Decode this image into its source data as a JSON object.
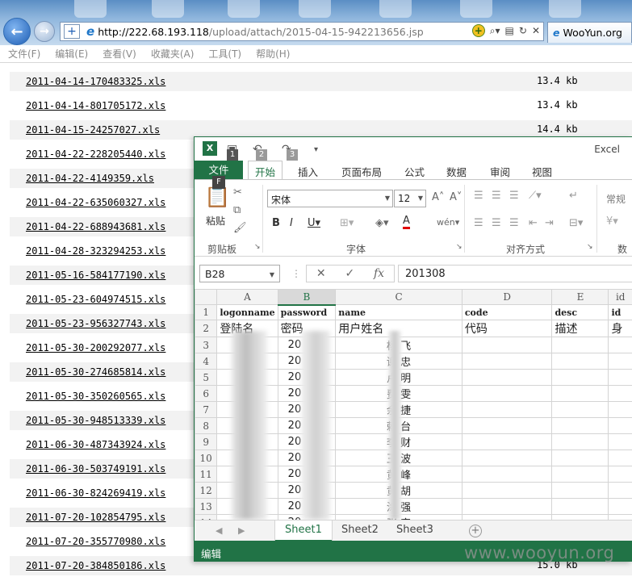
{
  "browser": {
    "url_domain": "http://222.68.193.118",
    "url_path": "/upload/attach/2015-04-15-942213656.jsp",
    "tab_title": "WooYun.org",
    "menu": [
      "文件(F)",
      "编辑(E)",
      "查看(V)",
      "收藏夹(A)",
      "工具(T)",
      "帮助(H)"
    ]
  },
  "files": [
    {
      "name": "2011-04-14-170483325.xls",
      "size": "13.4 kb"
    },
    {
      "name": "2011-04-14-801705172.xls",
      "size": "13.4 kb"
    },
    {
      "name": "2011-04-15-24257027.xls",
      "size": "14.4 kb"
    },
    {
      "name": "2011-04-22-228205440.xls",
      "size": ""
    },
    {
      "name": "2011-04-22-4149359.xls",
      "size": ""
    },
    {
      "name": "2011-04-22-635060327.xls",
      "size": ""
    },
    {
      "name": "2011-04-22-688943681.xls",
      "size": ""
    },
    {
      "name": "2011-04-28-323294253.xls",
      "size": ""
    },
    {
      "name": "2011-05-16-584177190.xls",
      "size": ""
    },
    {
      "name": "2011-05-23-604974515.xls",
      "size": ""
    },
    {
      "name": "2011-05-23-956327743.xls",
      "size": ""
    },
    {
      "name": "2011-05-30-200292077.xls",
      "size": ""
    },
    {
      "name": "2011-05-30-274685814.xls",
      "size": ""
    },
    {
      "name": "2011-05-30-350260565.xls",
      "size": ""
    },
    {
      "name": "2011-05-30-948513339.xls",
      "size": ""
    },
    {
      "name": "2011-06-30-487343924.xls",
      "size": ""
    },
    {
      "name": "2011-06-30-503749191.xls",
      "size": ""
    },
    {
      "name": "2011-06-30-824269419.xls",
      "size": ""
    },
    {
      "name": "2011-07-20-102854795.xls",
      "size": ""
    },
    {
      "name": "2011-07-20-355770980.xls",
      "size": ""
    },
    {
      "name": "2011-07-20-384850186.xls",
      "size": "15.0 kb"
    }
  ],
  "excel": {
    "app_name": "Excel",
    "qat_keys": [
      "1",
      "2",
      "3"
    ],
    "file_key": "F",
    "tabs": [
      "文件",
      "开始",
      "插入",
      "页面布局",
      "公式",
      "数据",
      "审阅",
      "视图"
    ],
    "ribbon": {
      "paste_label": "粘贴",
      "font_name": "宋体",
      "font_size": "12",
      "number_format": "常规",
      "groups": [
        "剪贴板",
        "字体",
        "对齐方式",
        "数字"
      ]
    },
    "name_box": "B28",
    "formula_value": "201308",
    "columns": [
      "A",
      "B",
      "C",
      "D",
      "E",
      "id"
    ],
    "header_row_en": [
      "logonname",
      "password",
      "name",
      "code",
      "desc",
      "id"
    ],
    "header_row_cn": [
      "登陆名",
      "密码",
      "用户姓名",
      "代码",
      "描述",
      "身"
    ],
    "rows": [
      {
        "num": "3",
        "a": "",
        "b": "20",
        "c": "杨 飞"
      },
      {
        "num": "4",
        "a": "",
        "b": "20",
        "c": "谢 忠"
      },
      {
        "num": "5",
        "a": "",
        "b": "20",
        "c": "卢 明"
      },
      {
        "num": "6",
        "a": "",
        "b": "20",
        "c": "费 雯"
      },
      {
        "num": "7",
        "a": "",
        "b": "20",
        "c": "余 捷"
      },
      {
        "num": "8",
        "a": "2",
        "b": "20",
        "c": "赖 台"
      },
      {
        "num": "9",
        "a": "2",
        "b": "20",
        "c": "李 财"
      },
      {
        "num": "10",
        "a": "2",
        "b": "20",
        "c": "王 波"
      },
      {
        "num": "11",
        "a": "",
        "b": "20",
        "c": "黄 峰"
      },
      {
        "num": "12",
        "a": "",
        "b": "20",
        "c": "黄 胡"
      },
      {
        "num": "13",
        "a": "",
        "b": "20",
        "c": "涂 强"
      },
      {
        "num": "14",
        "a": "",
        "b": "20",
        "c": "张 字"
      }
    ],
    "sheets": [
      "Sheet1",
      "Sheet2",
      "Sheet3"
    ],
    "status": "编辑"
  },
  "watermark": "www.wooyun.org"
}
